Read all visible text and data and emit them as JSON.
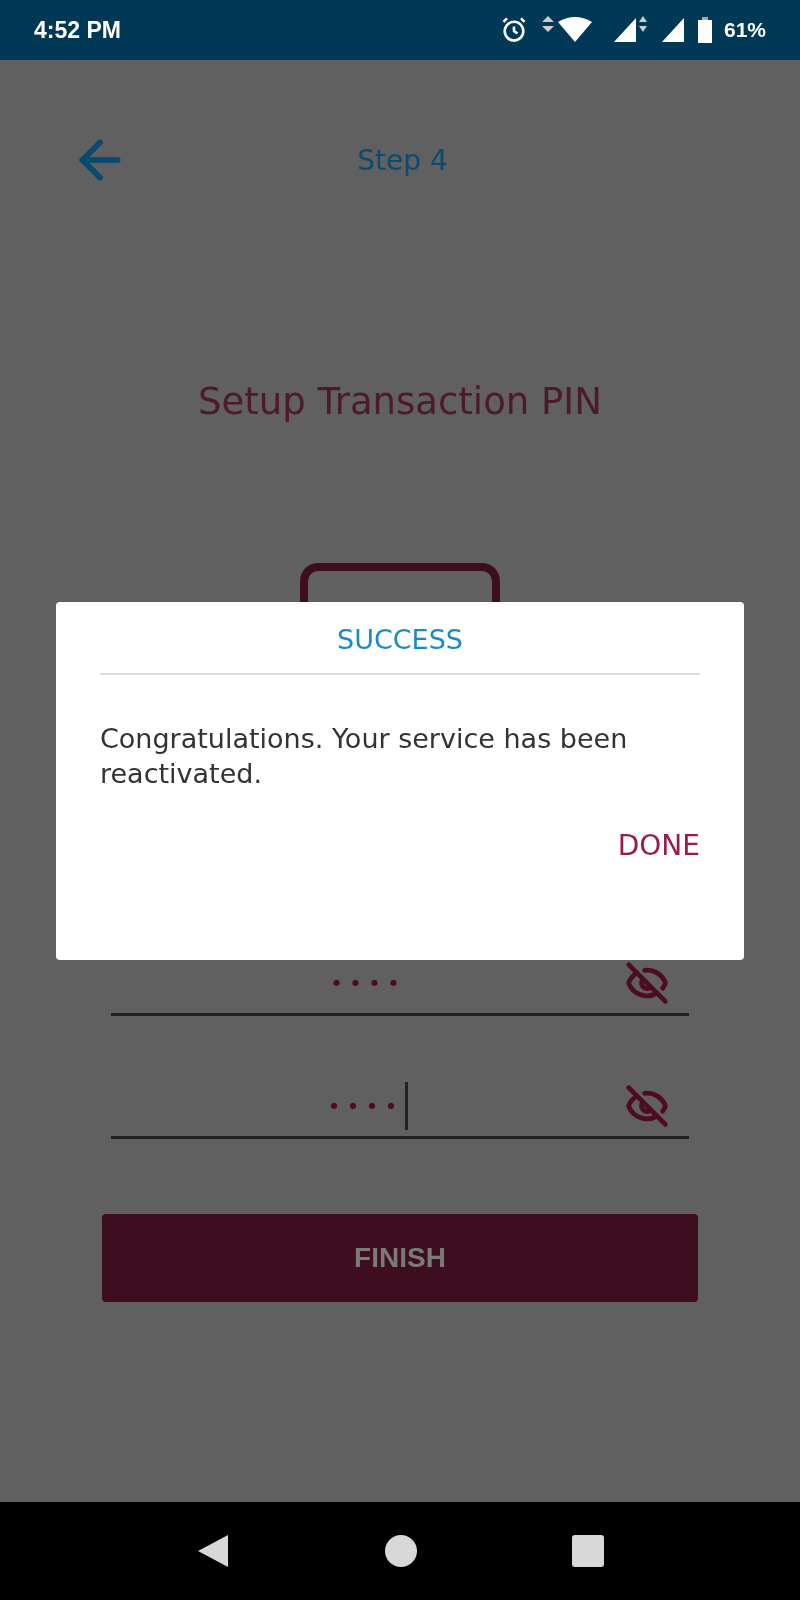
{
  "status_bar": {
    "time": "4:52 PM",
    "battery": "61%"
  },
  "header": {
    "title": "Step 4"
  },
  "page_title": "Setup Transaction PIN",
  "pin_fields": [
    {
      "value": "••••",
      "focused": false
    },
    {
      "value": "••••",
      "focused": true
    }
  ],
  "finish_button": "FINISH",
  "dialog": {
    "title": "SUCCESS",
    "message": "Congratulations. Your service has been reactivated.",
    "button": "DONE"
  }
}
